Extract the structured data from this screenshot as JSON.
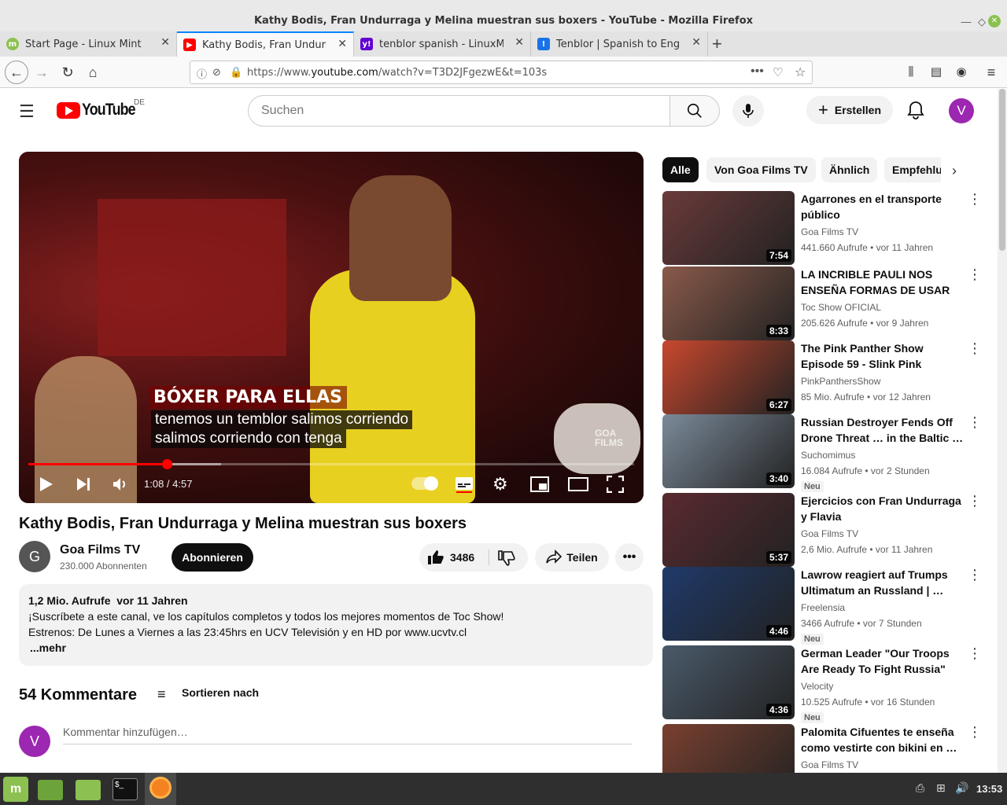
{
  "window": {
    "title": "Kathy Bodis, Fran Undurraga y Melina muestran sus boxers - YouTube - Mozilla Firefox"
  },
  "tabs": [
    {
      "label": "Start Page - Linux Mint",
      "icon": "mint-icon",
      "color": "#8cc152"
    },
    {
      "label": "Kathy Bodis, Fran Undurraga y",
      "icon": "youtube-icon",
      "color": "#ff0000"
    },
    {
      "label": "tenblor spanish - LinuxMint",
      "icon": "yahoo-icon",
      "color": "#6001d2"
    },
    {
      "label": "Tenblor | Spanish to English",
      "icon": "spanishdict-icon",
      "color": "#1a73e8"
    }
  ],
  "urlbar": {
    "prefix": "https://www.",
    "domain": "youtube.com",
    "path": "/watch?v=T3D2JFgezwE&t=103s"
  },
  "youtube": {
    "logo_text": "YouTube",
    "region": "DE",
    "search_placeholder": "Suchen",
    "create_label": "Erstellen",
    "avatar_letter": "V"
  },
  "player": {
    "caption_title": "BÓXER PARA ELLAS",
    "subtitle_line1": "tenemos un temblor salimos corriendo",
    "subtitle_line2": "salimos corriendo con tenga",
    "watermark": "GOA FILMS",
    "time": "1:08 / 4:57",
    "progress": 0.229
  },
  "video": {
    "title": "Kathy Bodis, Fran Undurraga y Melina muestran sus boxers",
    "channel": "Goa Films TV",
    "channel_letter": "G",
    "subscribers": "230.000 Abonnenten",
    "subscribe_label": "Abonnieren",
    "likes": "3486",
    "share_label": "Teilen"
  },
  "description": {
    "stats": "1,2 Mio. Aufrufe  vor 11 Jahren",
    "line1": "¡Suscríbete a este canal, ve los capítulos completos y todos los mejores momentos de Toc Show!",
    "line2": "Estrenos: De Lunes a Viernes a las 23:45hrs en UCV Televisión y en HD por www.ucvtv.cl",
    "more": "...mehr"
  },
  "comments": {
    "count_label": "54 Kommentare",
    "sort_label": "Sortieren nach",
    "add_placeholder": "Kommentar hinzufügen…",
    "avatar_letter": "V"
  },
  "chips": [
    "Alle",
    "Von Goa Films TV",
    "Ähnlich",
    "Empfehlu"
  ],
  "recommendations": [
    {
      "title": "Agarrones en el transporte público",
      "channel": "Goa Films TV",
      "meta": "441.660 Aufrufe • vor 11 Jahren",
      "duration": "7:54",
      "new": "",
      "thumb": "#6b3a3a"
    },
    {
      "title": "LA INCRIBLE PAULI NOS ENSEÑA FORMAS DE USAR UN…",
      "channel": "Toc Show OFICIAL",
      "meta": "205.626 Aufrufe • vor 9 Jahren",
      "duration": "8:33",
      "new": "",
      "thumb": "#8a5a4a"
    },
    {
      "title": "The Pink Panther Show Episode 59 - Slink Pink",
      "channel": "PinkPanthersShow",
      "meta": "85 Mio. Aufrufe • vor 12 Jahren",
      "duration": "6:27",
      "new": "",
      "thumb": "#c8482e"
    },
    {
      "title": "Russian Destroyer Fends Off Drone Threat … in the Baltic …",
      "channel": "Suchomimus",
      "meta": "16.084 Aufrufe • vor 2 Stunden",
      "duration": "3:40",
      "new": "Neu",
      "thumb": "#7b8a99"
    },
    {
      "title": "Ejercicios con Fran Undurraga y Flavia",
      "channel": "Goa Films TV",
      "meta": "2,6 Mio. Aufrufe • vor 11 Jahren",
      "duration": "5:37",
      "new": "",
      "thumb": "#5a2a30"
    },
    {
      "title": "Lawrow reagiert auf Trumps Ultimatum an Russland | …",
      "channel": "Freelensia",
      "meta": "3466 Aufrufe • vor 7 Stunden",
      "duration": "4:46",
      "new": "Neu",
      "thumb": "#1f3a6a"
    },
    {
      "title": "German Leader \"Our Troops Are Ready To Fight Russia\"",
      "channel": "Velocity",
      "meta": "10.525 Aufrufe • vor 16 Stunden",
      "duration": "4:36",
      "new": "Neu",
      "thumb": "#4a5a6a"
    },
    {
      "title": "Palomita Cifuentes te enseña como vestirte con bikini en …",
      "channel": "Goa Films TV",
      "meta": "",
      "duration": "",
      "new": "",
      "thumb": "#7a4030"
    }
  ],
  "taskbar": {
    "clock": "13:53"
  }
}
